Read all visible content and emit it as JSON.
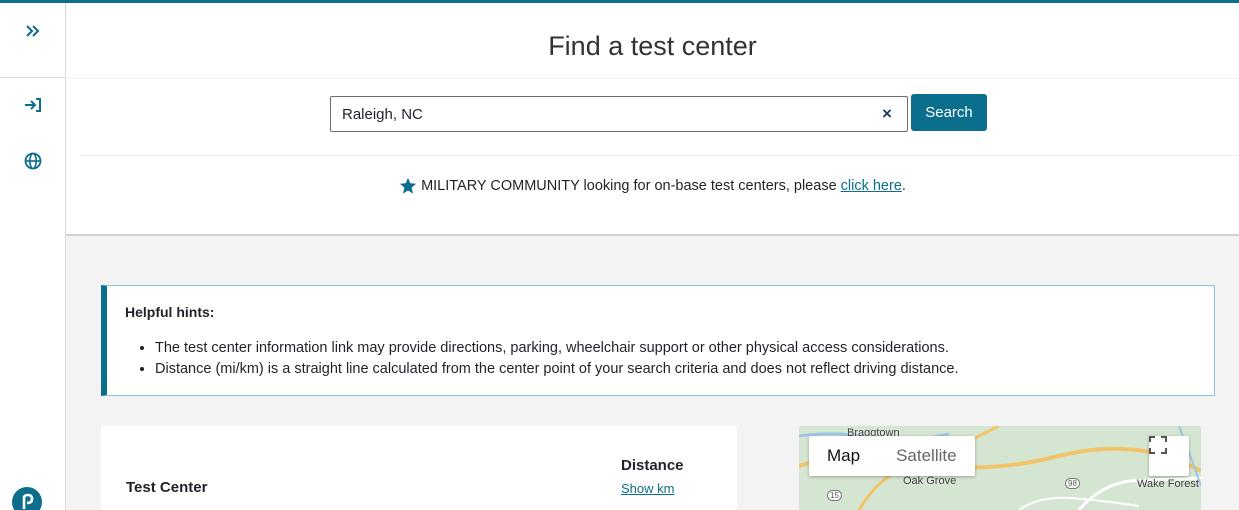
{
  "page": {
    "title": "Find a test center"
  },
  "search": {
    "value": "Raleigh, NC",
    "clear_symbol": "×",
    "button_label": "Search"
  },
  "military": {
    "text": "MILITARY COMMUNITY looking for on-base test centers, please",
    "link_text": "click here",
    "suffix": "."
  },
  "hints": {
    "title": "Helpful hints:",
    "items": [
      "The test center information link may provide directions, parking, wheelchair support or other physical access considerations.",
      "Distance (mi/km) is a straight line calculated from the center point of your search criteria and does not reflect driving distance."
    ]
  },
  "results": {
    "col_center": "Test Center",
    "col_distance": "Distance",
    "units_toggle": "Show km"
  },
  "map": {
    "tab_map": "Map",
    "tab_satellite": "Satellite",
    "places": [
      "Bragqtown",
      "Oak Grove",
      "Wake Forest"
    ],
    "routes": [
      "15",
      "98"
    ]
  },
  "icons": {
    "expand": "double-chevron-right-icon",
    "sign_in": "sign-in-icon",
    "language": "globe-icon",
    "brand": "pearson-logo-icon",
    "star": "star-icon",
    "fullscreen": "fullscreen-icon"
  },
  "colors": {
    "accent": "#0b6e8c",
    "text": "#1f2329",
    "content_bg": "#f3f3f4"
  }
}
